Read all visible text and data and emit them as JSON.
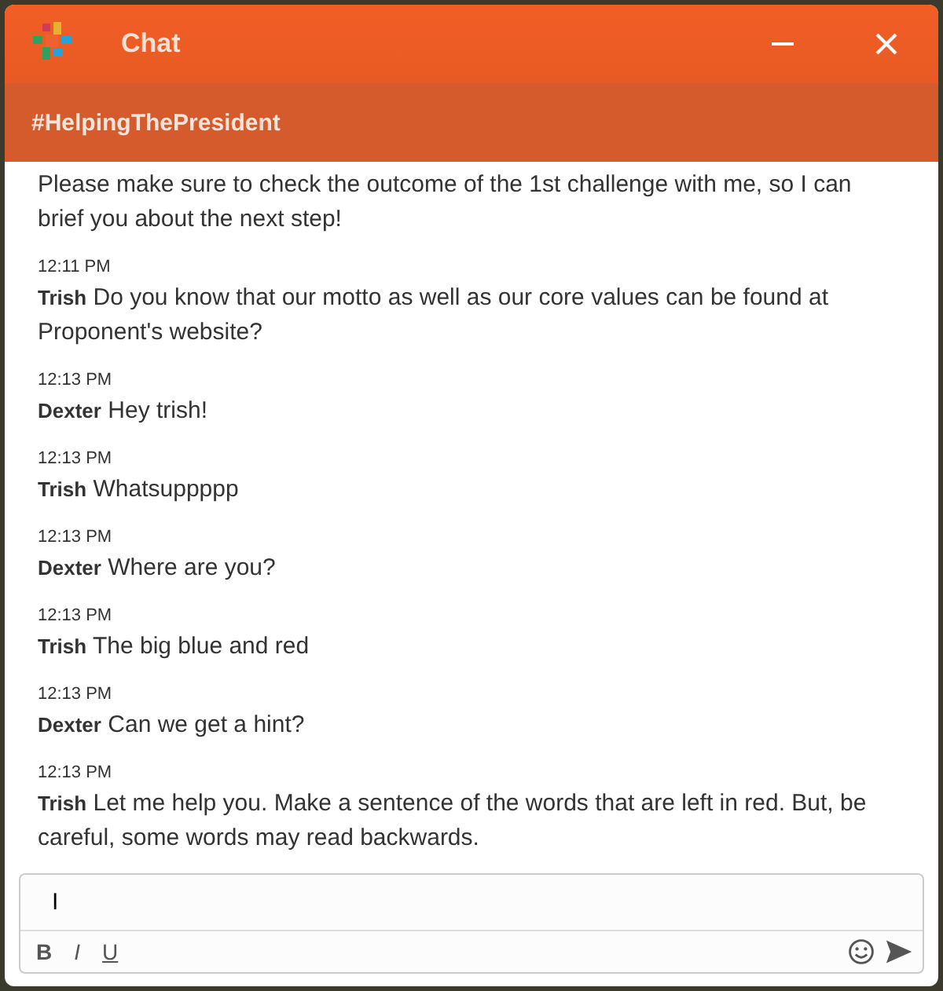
{
  "window": {
    "title": "Chat"
  },
  "channel": {
    "name": "#HelpingThePresident"
  },
  "messages": [
    {
      "text": "Please make sure to check the outcome of the 1st challenge with me, so I can brief you about the next step!"
    },
    {
      "time": "12:11 PM",
      "sender": "Trish",
      "text": "Do you know that our motto as well as our core values can be found at Proponent's website?"
    },
    {
      "time": "12:13 PM",
      "sender": "Dexter",
      "text": "Hey trish!"
    },
    {
      "time": "12:13 PM",
      "sender": "Trish",
      "text": "Whatsuppppp"
    },
    {
      "time": "12:13 PM",
      "sender": "Dexter",
      "text": "Where are you?"
    },
    {
      "time": "12:13 PM",
      "sender": "Trish",
      "text": "The big blue and red"
    },
    {
      "time": "12:13 PM",
      "sender": "Dexter",
      "text": "Can we get a hint?"
    },
    {
      "time": "12:13 PM",
      "sender": "Trish",
      "text": "Let me help you. Make a sentence of the words that are left in red. But, be careful, some words may read backwards."
    }
  ],
  "composer": {
    "value": "I",
    "format_buttons": [
      "B",
      "I",
      "U"
    ]
  }
}
